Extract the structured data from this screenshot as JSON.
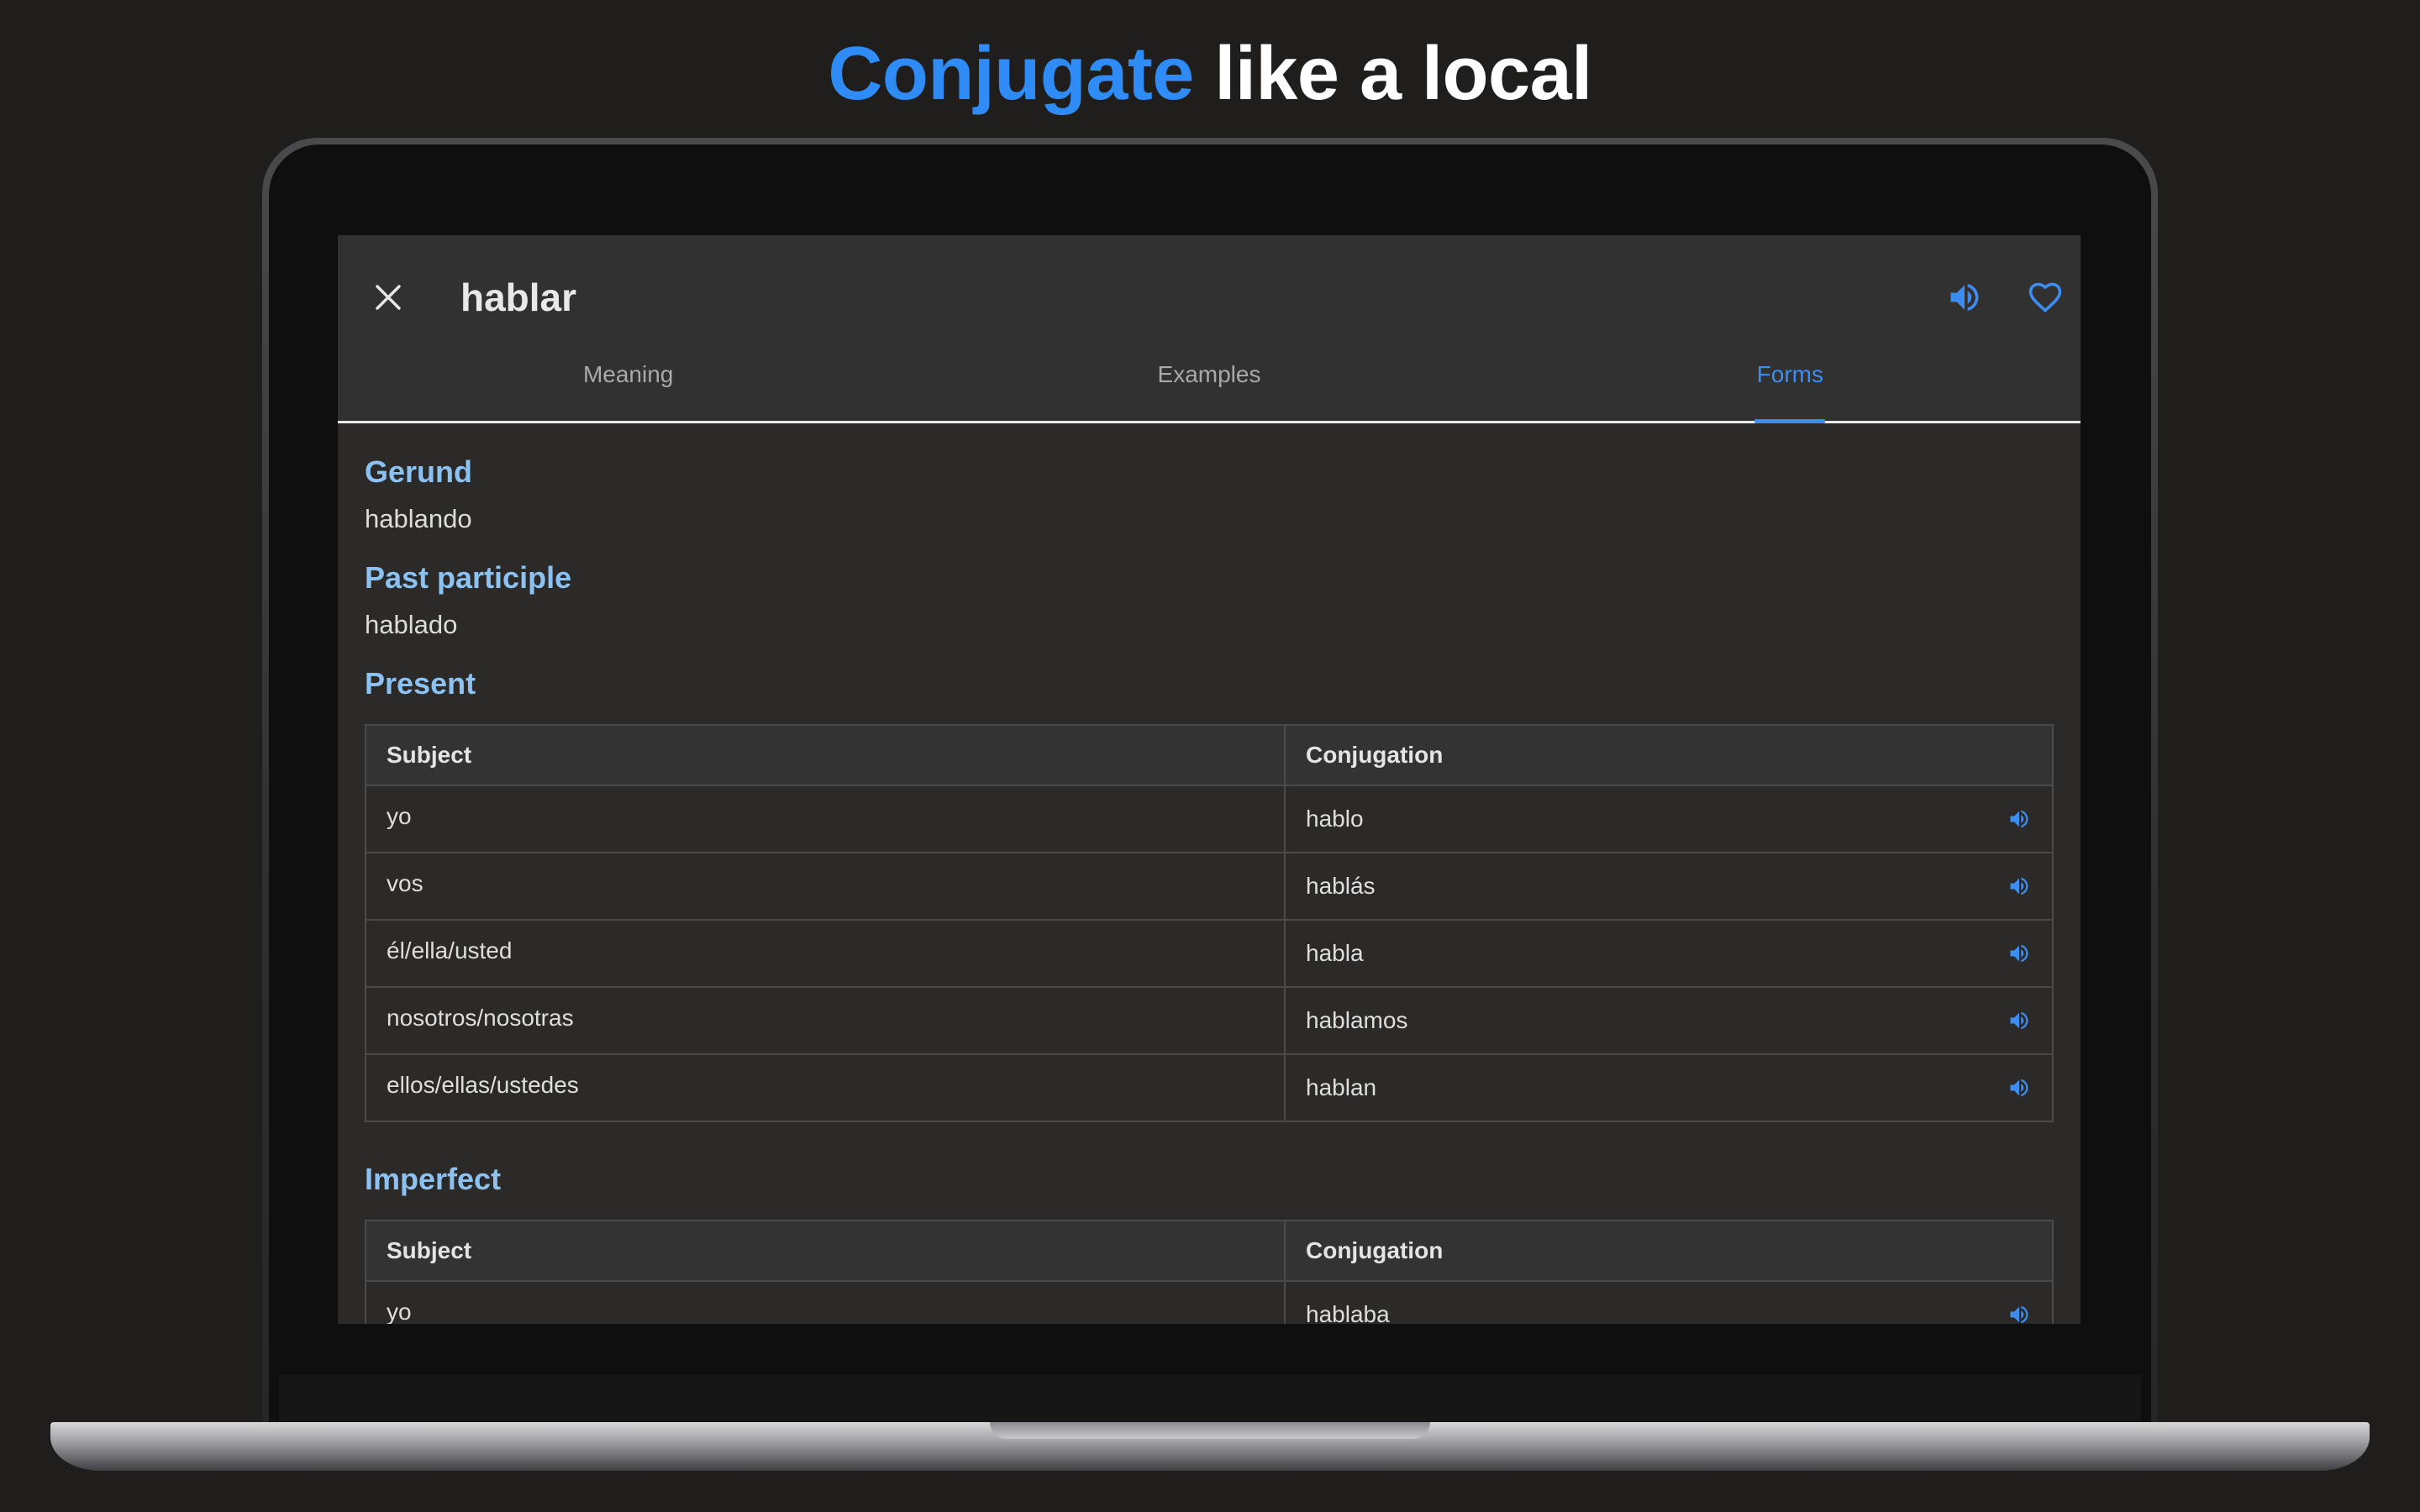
{
  "headline": {
    "accent": "Conjugate",
    "rest": " like a local"
  },
  "app": {
    "title": "hablar",
    "icons": {
      "close": "close-icon",
      "speaker": "speaker-icon",
      "favorite": "heart-icon"
    },
    "colors": {
      "accent": "#3d8cf0",
      "section_heading": "#8cc2f1",
      "headline_accent": "#2f8cf7"
    },
    "tabs": [
      {
        "label": "Meaning",
        "active": false
      },
      {
        "label": "Examples",
        "active": false
      },
      {
        "label": "Forms",
        "active": true
      }
    ],
    "gerund": {
      "label": "Gerund",
      "value": "hablando"
    },
    "past_participle": {
      "label": "Past participle",
      "value": "hablado"
    },
    "present": {
      "label": "Present",
      "headers": [
        "Subject",
        "Conjugation"
      ],
      "rows": [
        {
          "subject": "yo",
          "form": "hablo"
        },
        {
          "subject": "vos",
          "form": "hablás"
        },
        {
          "subject": "él/ella/usted",
          "form": "habla"
        },
        {
          "subject": "nosotros/nosotras",
          "form": "hablamos"
        },
        {
          "subject": "ellos/ellas/ustedes",
          "form": "hablan"
        }
      ]
    },
    "imperfect": {
      "label": "Imperfect",
      "headers": [
        "Subject",
        "Conjugation"
      ],
      "rows": [
        {
          "subject": "yo",
          "form": "hablaba"
        }
      ]
    }
  }
}
